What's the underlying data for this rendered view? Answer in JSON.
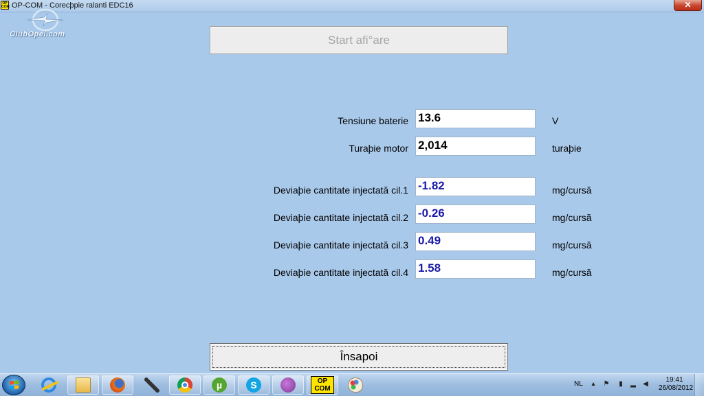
{
  "window": {
    "title": "OP-COM - Corecþpie ralanti EDC16",
    "icon_text": [
      "OP",
      "COM"
    ],
    "close_glyph": "✕"
  },
  "logo": {
    "text": "ClubOpel.com"
  },
  "start_button": {
    "label": "Start afi°are"
  },
  "readings": [
    {
      "label": "Tensiune baterie",
      "value": "13.6",
      "unit": "V",
      "value_color": "#000000"
    },
    {
      "label": "Turaþie motor",
      "value": "2,014",
      "unit": "turaþie",
      "value_color": "#000000"
    },
    {
      "label": "Deviaþie cantitate injectată cil.1",
      "value": "-1.82",
      "unit": "mg/cursă",
      "value_color": "#1a1aa8"
    },
    {
      "label": "Deviaþie cantitate injectată cil.2",
      "value": "-0.26",
      "unit": "mg/cursă",
      "value_color": "#1a1aa8"
    },
    {
      "label": "Deviaþie cantitate injectată cil.3",
      "value": "0.49",
      "unit": "mg/cursă",
      "value_color": "#1a1aa8"
    },
    {
      "label": "Deviaþie cantitate injectată cil.4",
      "value": "1.58",
      "unit": "mg/cursă",
      "value_color": "#1a1aa8"
    }
  ],
  "back_button": {
    "label": "Însapoi"
  },
  "taskbar": {
    "apps": [
      "internet-explorer",
      "file-explorer",
      "firefox",
      "tool",
      "chrome",
      "utorrent",
      "skype",
      "messenger",
      "op-com",
      "paint"
    ],
    "opcom_icon_text": [
      "OP",
      "COM"
    ],
    "utorrent_glyph": "µ",
    "skype_glyph": "S",
    "language": "NL",
    "clock_time": "19:41",
    "clock_date": "26/08/2012"
  }
}
